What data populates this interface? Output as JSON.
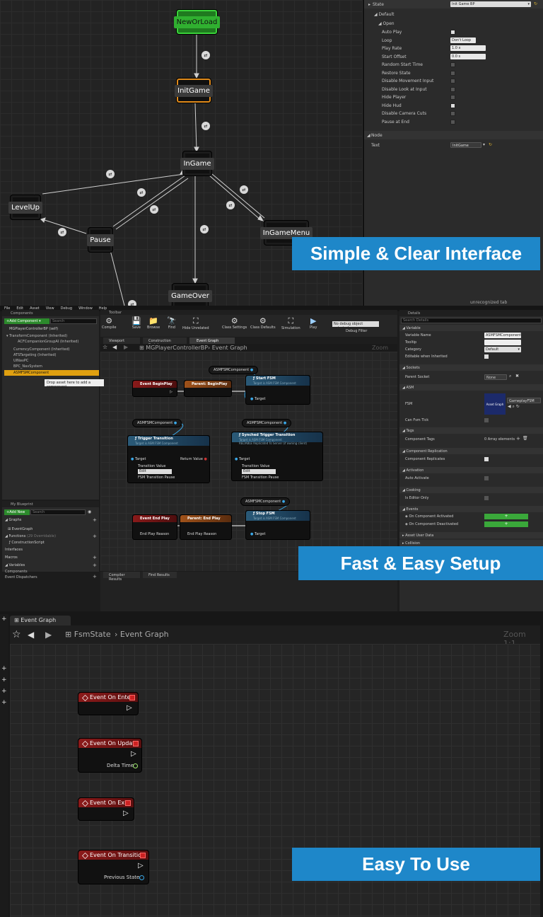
{
  "panel1": {
    "states": {
      "new_or_load": "NewOrLoad",
      "init_game": "InitGame",
      "in_game": "InGame",
      "level_up": "LevelUp",
      "pause": "Pause",
      "in_game_menu": "InGameMenu",
      "game_over": "GameOver"
    },
    "details": {
      "state_label": "State",
      "state_value": "Init Game BP",
      "default_label": "Default",
      "open_label": "Open",
      "rows": [
        {
          "label": "Auto Play",
          "kind": "check",
          "checked": true
        },
        {
          "label": "Loop",
          "kind": "select",
          "value": "Don't Loop"
        },
        {
          "label": "Play Rate",
          "kind": "field",
          "value": "1.0 x"
        },
        {
          "label": "Start Offset",
          "kind": "field",
          "value": "0.0 s"
        },
        {
          "label": "Random Start Time",
          "kind": "check",
          "checked": false
        },
        {
          "label": "Restore State",
          "kind": "check",
          "checked": false
        },
        {
          "label": "Disable Movement Input",
          "kind": "check",
          "checked": false
        },
        {
          "label": "Disable Look at Input",
          "kind": "check",
          "checked": false
        },
        {
          "label": "Hide Player",
          "kind": "check",
          "checked": false
        },
        {
          "label": "Hide Hud",
          "kind": "check",
          "checked": true
        },
        {
          "label": "Disable Camera Cuts",
          "kind": "check",
          "checked": false
        },
        {
          "label": "Pause at End",
          "kind": "check",
          "checked": false
        }
      ],
      "node_label": "Node",
      "text_label": "Text",
      "text_value": "InitGame",
      "tab_note": "unrecognized tab"
    },
    "banner": "Simple & Clear Interface"
  },
  "panel2": {
    "menu": [
      "File",
      "Edit",
      "Asset",
      "View",
      "Debug",
      "Window",
      "Help"
    ],
    "components": {
      "header": "Components",
      "add_button": "+Add Component",
      "search_placeholder": "Search",
      "self": "MGPlayerControllerBP (self)",
      "items": [
        "TransformComponent (Inherited)",
        "ACFCompanionGroupAI (Inherited)",
        "CurrencyComponent (Inherited)",
        "ATSTargeting (Inherited)",
        "UINavPC",
        "BPC_NavSystem",
        "ASMFSMComponent"
      ],
      "tooltip": "Drop asset here to add a component."
    },
    "my_blueprint": {
      "header": "My Blueprint",
      "add_new": "+Add New",
      "search_placeholder": "Search",
      "graphs": "Graphs",
      "event_graph": "EventGraph",
      "functions": "Functions",
      "functions_count": "(29 Overridable)",
      "construction_script": "ConstructionScript",
      "interfaces": "Interfaces",
      "macros": "Macros",
      "variables": "Variables",
      "components": "Components",
      "event_dispatchers": "Event Dispatchers"
    },
    "toolbar": {
      "header": "Toolbar",
      "buttons": [
        "Compile",
        "Save",
        "Browse",
        "Find",
        "Hide Unrelated",
        "Class Settings",
        "Class Defaults",
        "Simulation",
        "Play"
      ],
      "debug_select": "No debug object selected",
      "debug_filter": "Debug Filter"
    },
    "tabs": [
      "Viewport",
      "Construction Script",
      "Event Graph"
    ],
    "breadcrumb": {
      "root": "MGPlayerControllerBP",
      "leaf": "Event Graph",
      "zoom": "Zoom 1:1"
    },
    "nodes": {
      "comp1": "ASMFSMComponent",
      "event_begin_play": "Event BeginPlay",
      "parent_begin_play": "Parent: BeginPlay",
      "start_fsm": "Start FSM",
      "start_fsm_sub": "Target is ASM FSM Component",
      "target": "Target",
      "comp2": "ASMFSMComponent",
      "comp3": "ASMFSMComponent",
      "trigger_transition": "Trigger Transition",
      "trigger_sub": "Target is ASM FSM Component",
      "return_value": "Return Value",
      "transition_value": "Transition Value",
      "trans_select": "Edit",
      "fsm_pause": "FSM Transition Pause",
      "synced_trigger": "Synched Trigger Transition",
      "synced_sub1": "Target is ASM FSM Component",
      "synced_sub2": "RELIABLE Replicated To Server (if owning client)",
      "comp4": "ASMFSMComponent",
      "event_end_play": "Event End Play",
      "parent_end_play": "Parent: End Play",
      "stop_fsm": "Stop FSM",
      "stop_fsm_sub": "Target is ASM FSM Component",
      "end_play_reason": "End Play Reason"
    },
    "bottom_tabs": [
      "Compiler Results",
      "Find Results"
    ],
    "details": {
      "header": "Details",
      "search_placeholder": "Search Details",
      "variable": "Variable",
      "variable_name_label": "Variable Name",
      "variable_name": "ASMFSMComponent",
      "tooltip_label": "Tooltip",
      "category_label": "Category",
      "category_value": "Default",
      "editable_label": "Editable when Inherited",
      "sockets": "Sockets",
      "parent_socket_label": "Parent Socket",
      "parent_socket_value": "None",
      "asm": "ASM",
      "fsm_label": "FSM",
      "fsm_thumb": "Asset Graph",
      "fsm_value": "GameplayFSM",
      "can_fsm_tick": "Can Fsm Tick",
      "tags": "Tags",
      "component_tags_label": "Component Tags",
      "component_tags_value": "0 Array elements",
      "replication": "Component Replication",
      "component_replicates": "Component Replicates",
      "activation": "Activation",
      "auto_activate": "Auto Activate",
      "cooking": "Cooking",
      "is_editor_only": "Is Editor Only",
      "events": "Events",
      "on_activated": "On Component Activated",
      "on_deactivated": "On Component Deactivated",
      "asset_user_data": "Asset User Data",
      "collision": "Collision"
    },
    "banner": "Fast & Easy Setup"
  },
  "panel3": {
    "tab": "Event Graph",
    "breadcrumb": {
      "root": "FsmState",
      "leaf": "Event Graph",
      "zoom": "Zoom 1:1"
    },
    "events": [
      {
        "title": "Event On Enter",
        "pin": ""
      },
      {
        "title": "Event On Update",
        "pin": "Delta Time"
      },
      {
        "title": "Event On Exit",
        "pin": ""
      },
      {
        "title": "Event On Transition",
        "pin": "Previous State"
      }
    ],
    "colors": {
      "delta_pin": "#9ee870",
      "state_pin": "#3aa8e8"
    },
    "banner": "Easy To Use"
  }
}
